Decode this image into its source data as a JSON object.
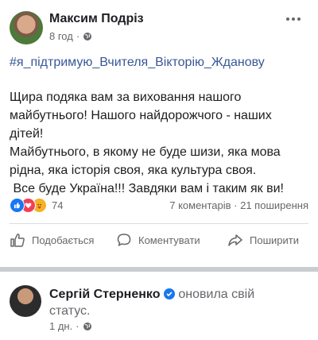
{
  "post": {
    "author": "Максим Подріз",
    "time": "8 год",
    "hashtag": "#я_підтримую_Вчителя_Вікторію_Жданову",
    "paragraphs": [
      "Щира подяка вам за виховання нашого",
      "майбутнього! Нашого найдорожчого - наших",
      "дітей!",
      "Майбутнього, в якому не буде шизи, яка мова",
      "рідна, яка історія своя, яка культура своя.",
      " Все буде Україна!!! Завдяки вам і таким як ви!"
    ],
    "reactions_count": "74",
    "stats": "7 коментарів · 21 поширення",
    "actions": {
      "like": "Подобається",
      "comment": "Коментувати",
      "share": "Поширити"
    }
  },
  "next_post": {
    "author": "Сергій Стерненко",
    "activity": "оновила свій",
    "activity2": "статус.",
    "time": "1 дн."
  },
  "colors": {
    "like": "#1877f2",
    "love": "#f33e58",
    "care": "#f7b125",
    "hashtag": "#385898"
  }
}
